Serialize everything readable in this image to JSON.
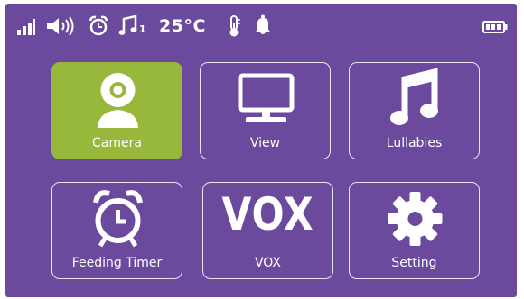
{
  "status_bar": {
    "icons": [
      "signal-icon",
      "volume-icon",
      "alarm-clock-icon",
      "lullaby-note-icon",
      "thermometer-icon",
      "bell-icon",
      "battery-icon"
    ],
    "lullaby_track": "1",
    "temperature": "25°C"
  },
  "menu": {
    "tiles": [
      {
        "label": "Camera",
        "icon": "camera-icon",
        "selected": true
      },
      {
        "label": "View",
        "icon": "monitor-icon",
        "selected": false
      },
      {
        "label": "Lullabies",
        "icon": "music-note-icon",
        "selected": false
      },
      {
        "label": "Feeding Timer",
        "icon": "alarm-clock-icon",
        "selected": false
      },
      {
        "label": "VOX",
        "icon_text": "VOX",
        "selected": false
      },
      {
        "label": "Setting",
        "icon": "gear-icon",
        "selected": false
      }
    ]
  },
  "colors": {
    "background": "#6b4a9e",
    "selected_tile": "#98b83c",
    "foreground": "#ffffff"
  }
}
